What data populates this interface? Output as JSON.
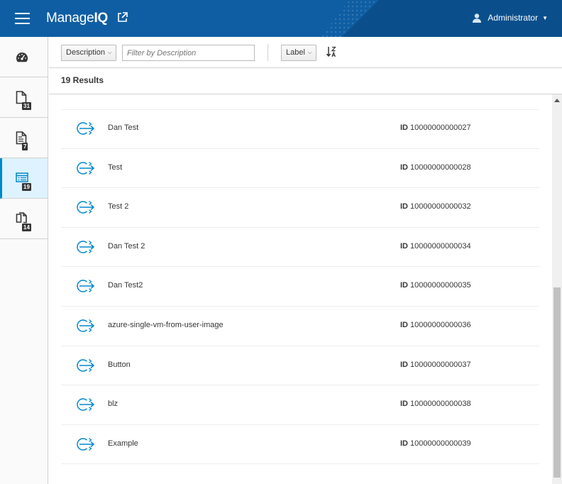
{
  "header": {
    "brand_regular": "Manage",
    "brand_bold": "IQ",
    "user_name": "Administrator"
  },
  "sidebar": {
    "items": [
      {
        "icon": "dashboard-icon",
        "badge": ""
      },
      {
        "icon": "document-icon",
        "badge": "31"
      },
      {
        "icon": "document-lines-icon",
        "badge": "7"
      },
      {
        "icon": "catalog-list-icon",
        "badge": "19",
        "active": true
      },
      {
        "icon": "copy-icon",
        "badge": "14"
      }
    ]
  },
  "toolbar": {
    "filter_field_label": "Description",
    "filter_placeholder": "Filter by Description",
    "sort_field_label": "Label"
  },
  "results_label": "19 Results",
  "list": {
    "id_label": "ID",
    "items": [
      {
        "name": "Dan Test",
        "id": "10000000000027"
      },
      {
        "name": "Test",
        "id": "10000000000028"
      },
      {
        "name": "Test 2",
        "id": "10000000000032"
      },
      {
        "name": "Dan Test 2",
        "id": "10000000000034"
      },
      {
        "name": "Dan Test2",
        "id": "10000000000035"
      },
      {
        "name": "azure-single-vm-from-user-image",
        "id": "10000000000036"
      },
      {
        "name": "Button",
        "id": "10000000000037"
      },
      {
        "name": "blz",
        "id": "10000000000038"
      },
      {
        "name": "Example",
        "id": "10000000000039"
      }
    ]
  },
  "colors": {
    "header_bg": "#0f5ea3",
    "active_nav_bg": "#def3ff",
    "active_nav_border": "#0088ce",
    "row_icon": "#0088ce"
  }
}
